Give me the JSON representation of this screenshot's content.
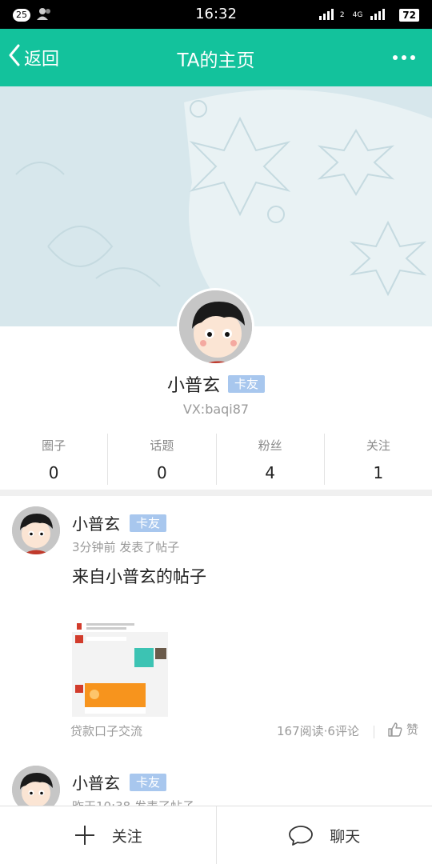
{
  "status_bar": {
    "notification_count": "25",
    "time": "16:32",
    "network_1": "2",
    "network_2": "4G",
    "battery": "72"
  },
  "nav": {
    "back_label": "返回",
    "title": "TA的主页"
  },
  "profile": {
    "name": "小普玄",
    "badge": "卡友",
    "vx": "VX:baqi87"
  },
  "stats": [
    {
      "label": "圈子",
      "value": "0"
    },
    {
      "label": "话题",
      "value": "0"
    },
    {
      "label": "粉丝",
      "value": "4"
    },
    {
      "label": "关注",
      "value": "1"
    }
  ],
  "posts": [
    {
      "author": "小普玄",
      "badge": "卡友",
      "meta": "3分钟前  发表了帖子",
      "title": "来自小普玄的帖子",
      "category": "贷款口子交流",
      "stats": "167阅读·6评论",
      "like_label": "赞"
    },
    {
      "author": "小普玄",
      "badge": "卡友",
      "meta": "昨天10:38  发表了帖子"
    }
  ],
  "bottom_bar": {
    "follow_label": "关注",
    "chat_label": "聊天"
  },
  "colors": {
    "brand": "#13c29c",
    "badge": "#a8c7ee",
    "cover": "#d7e7ec"
  }
}
